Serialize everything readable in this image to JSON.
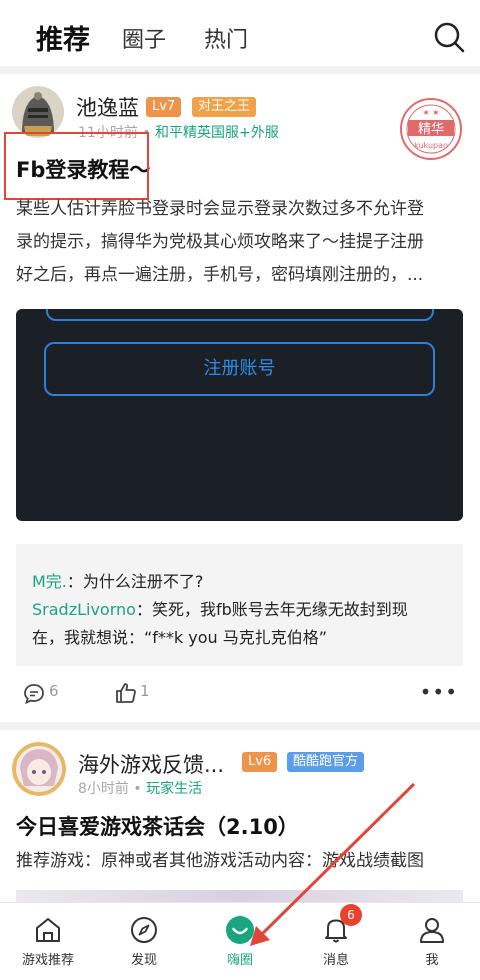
{
  "topnav": {
    "tabs": [
      {
        "label": "推荐",
        "active": true
      },
      {
        "label": "圈子",
        "active": false
      },
      {
        "label": "热门",
        "active": false
      }
    ],
    "search_icon": "search-icon"
  },
  "post1": {
    "username": "池逸蓝",
    "level_badge": "Lv7",
    "title_badge": "对王之王",
    "time": "11小时前",
    "circle": "和平精英国服+外服",
    "stamp_text": "精华",
    "stamp_sub": "kukupao",
    "title": "Fb登录教程～",
    "body_lines": [
      "某些人估计弄脸书登录时会显示登录次数过多不允许登",
      "录的提示，搞得华为党极其心烦攻略来了～挂提子注册",
      "好之后，再点一遍注册，手机号，密码填刚注册的，..."
    ],
    "image_button": "注册账号",
    "comments": [
      {
        "user": "M完.",
        "sep": "：",
        "text": "为什么注册不了?"
      },
      {
        "user": "SradzLivorno",
        "sep": "：",
        "text": "笑死，我fb账号去年无缘无故封到现"
      },
      {
        "user": "",
        "sep": "",
        "text": "在，我就想说：“f**k you 马克扎克伯格”"
      }
    ],
    "comment_count": "6",
    "like_count": "1",
    "more": "•••"
  },
  "post2": {
    "username": "海外游戏反馈...",
    "level_badge": "Lv6",
    "title_badge": "酷酷跑官方",
    "time": "8小时前",
    "circle": "玩家生活",
    "title": "今日喜爱游戏茶话会（2.10）",
    "body": "推荐游戏：原神或者其他游戏活动内容：游戏战绩截图"
  },
  "bottombar": {
    "items": [
      {
        "label": "游戏推荐",
        "icon": "home-icon"
      },
      {
        "label": "发现",
        "icon": "compass-icon"
      },
      {
        "label": "嗨圈",
        "icon": "chat-bubble-icon"
      },
      {
        "label": "消息",
        "icon": "bell-icon"
      },
      {
        "label": "我",
        "icon": "user-icon"
      }
    ],
    "notification_count": "6"
  },
  "colors": {
    "accent_green": "#1aa57e",
    "badge_orange": "#f0934a",
    "badge_blue": "#5b9de8",
    "highlight_red": "#e0463c"
  }
}
